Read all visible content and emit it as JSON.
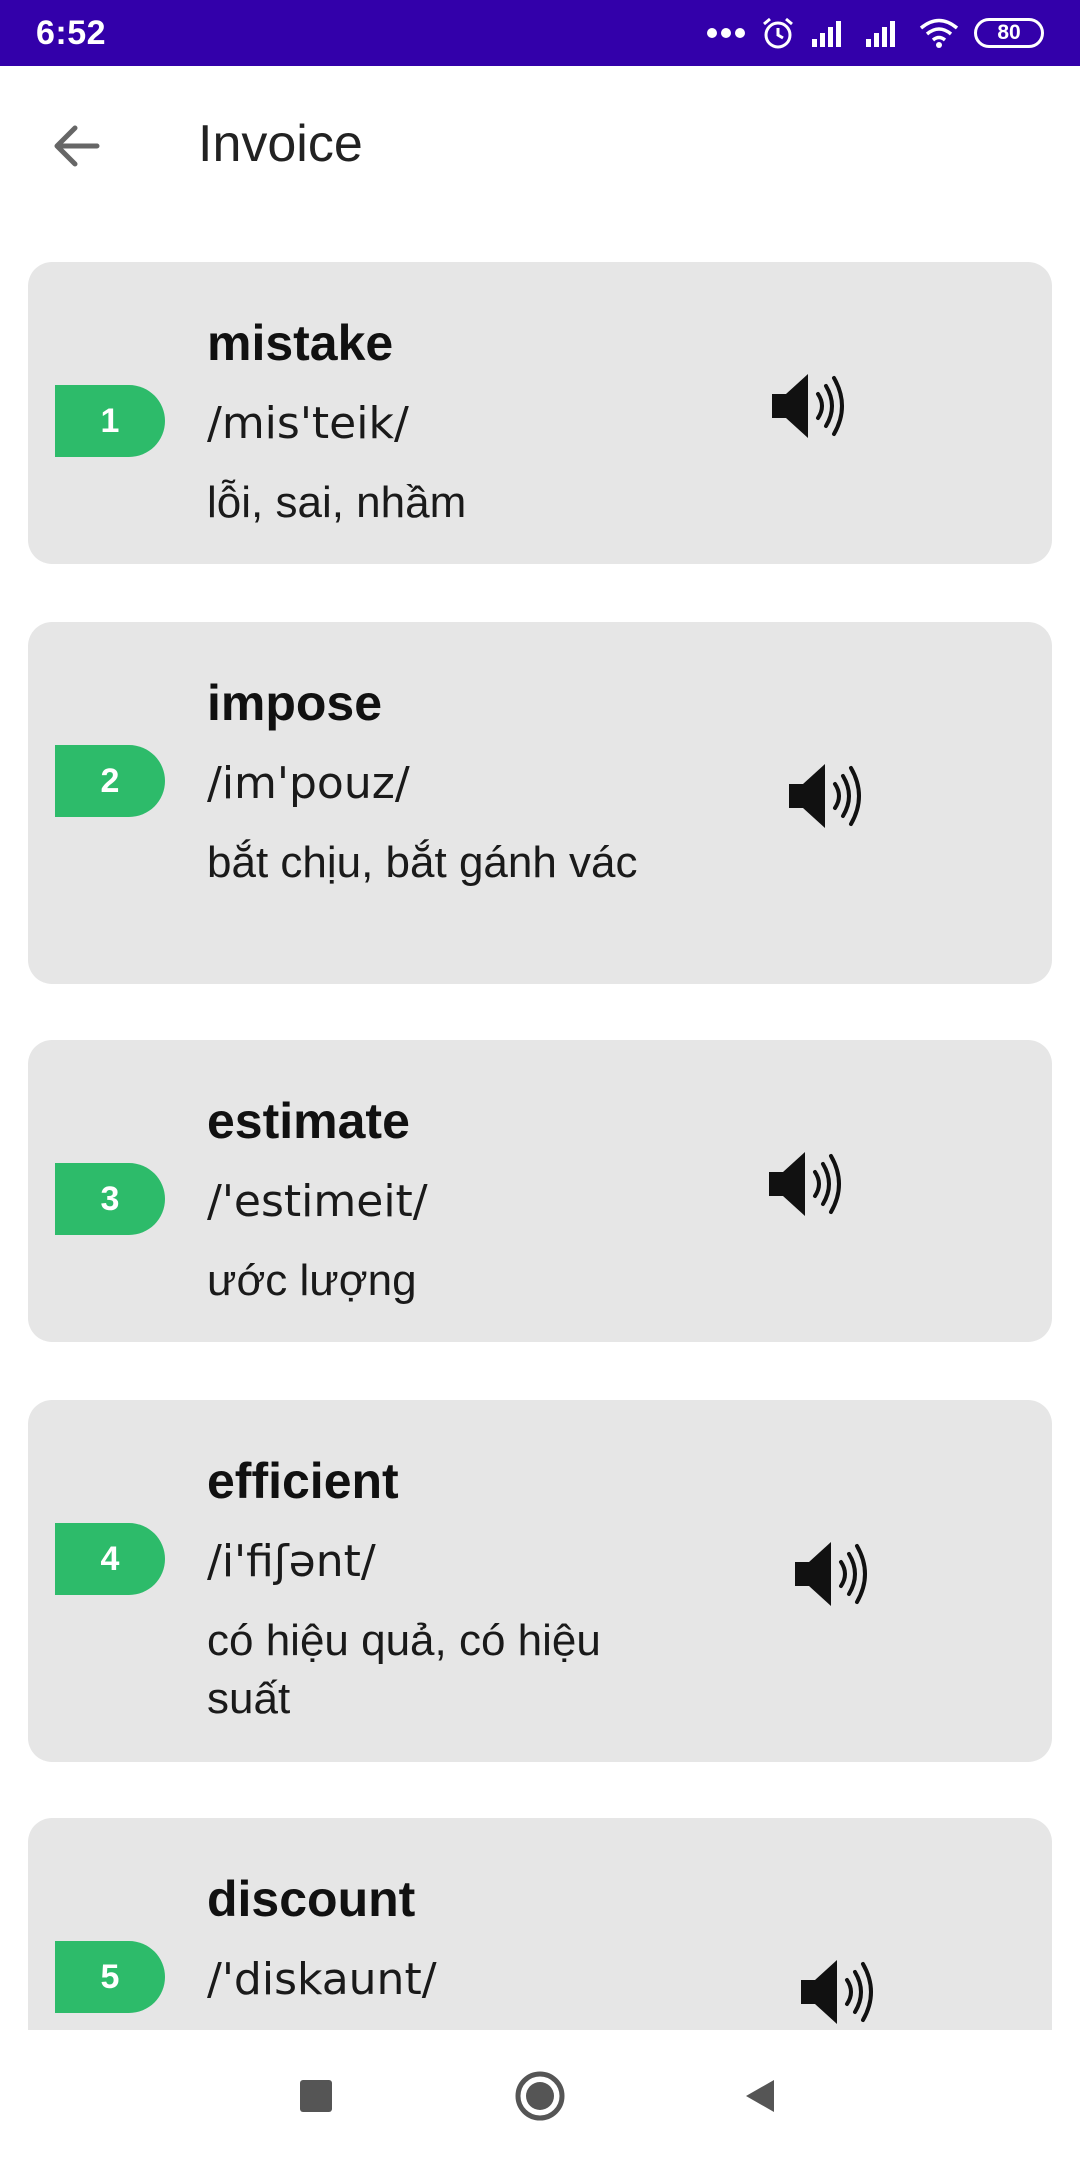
{
  "status_bar": {
    "time": "6:52",
    "battery": "80",
    "icons": [
      "more-dots-icon",
      "alarm-icon",
      "signal-icon",
      "signal-icon",
      "wifi-icon",
      "battery-icon"
    ]
  },
  "app_bar": {
    "title": "Invoice",
    "back_icon": "arrow-left-icon"
  },
  "words": [
    {
      "index": "1",
      "word": "mistake",
      "phonetic": "/mis'teik/",
      "meaning": "lỗi, sai, nhầm"
    },
    {
      "index": "2",
      "word": "impose",
      "phonetic": "/im'pouz/",
      "meaning": "bắt chịu, bắt gánh vác"
    },
    {
      "index": "3",
      "word": "estimate",
      "phonetic": "/'estimeit/",
      "meaning": "ước lượng"
    },
    {
      "index": "4",
      "word": "efficient",
      "phonetic": "/i'fiʃənt/",
      "meaning": "có hiệu quả, có hiệu suất"
    },
    {
      "index": "5",
      "word": "discount",
      "phonetic": "/'diskaunt/",
      "meaning": ""
    }
  ],
  "nav_bar": {
    "icons": [
      "recents-square-icon",
      "home-circle-icon",
      "back-triangle-icon"
    ]
  },
  "colors": {
    "status_bar": "#3300aa",
    "badge": "#2dbb6a",
    "card": "#e6e6e6"
  }
}
